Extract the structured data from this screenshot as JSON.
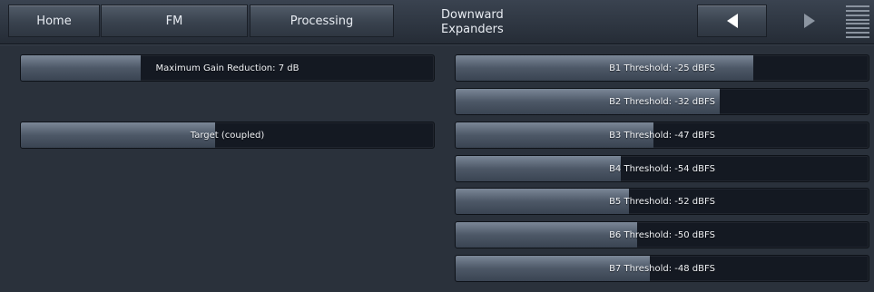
{
  "nav": {
    "home": "Home",
    "fm": "FM",
    "processing": "Processing",
    "title_line1": "Downward",
    "title_line2": "Expanders",
    "prev_icon": "triangle-left-icon",
    "next_icon": "triangle-right-icon",
    "menu_icon": "hamburger-menu-icon"
  },
  "left_controls": {
    "max_gain_reduction": {
      "label": "Maximum Gain Reduction: 7 dB",
      "level": 0.29
    },
    "target": {
      "label": "Target (coupled)",
      "level": 0.47
    }
  },
  "thresholds": [
    {
      "label": "B1 Threshold: -25 dBFS",
      "level": 0.72
    },
    {
      "label": "B2 Threshold: -32 dBFS",
      "level": 0.64
    },
    {
      "label": "B3 Threshold: -47 dBFS",
      "level": 0.48
    },
    {
      "label": "B4 Threshold: -54 dBFS",
      "level": 0.4
    },
    {
      "label": "B5 Threshold: -52 dBFS",
      "level": 0.42
    },
    {
      "label": "B6 Threshold: -50 dBFS",
      "level": 0.44
    },
    {
      "label": "B7 Threshold: -48 dBFS",
      "level": 0.47
    }
  ],
  "colors": {
    "background": "#2a313b",
    "fill": "#5b6676",
    "track": "#141922"
  }
}
